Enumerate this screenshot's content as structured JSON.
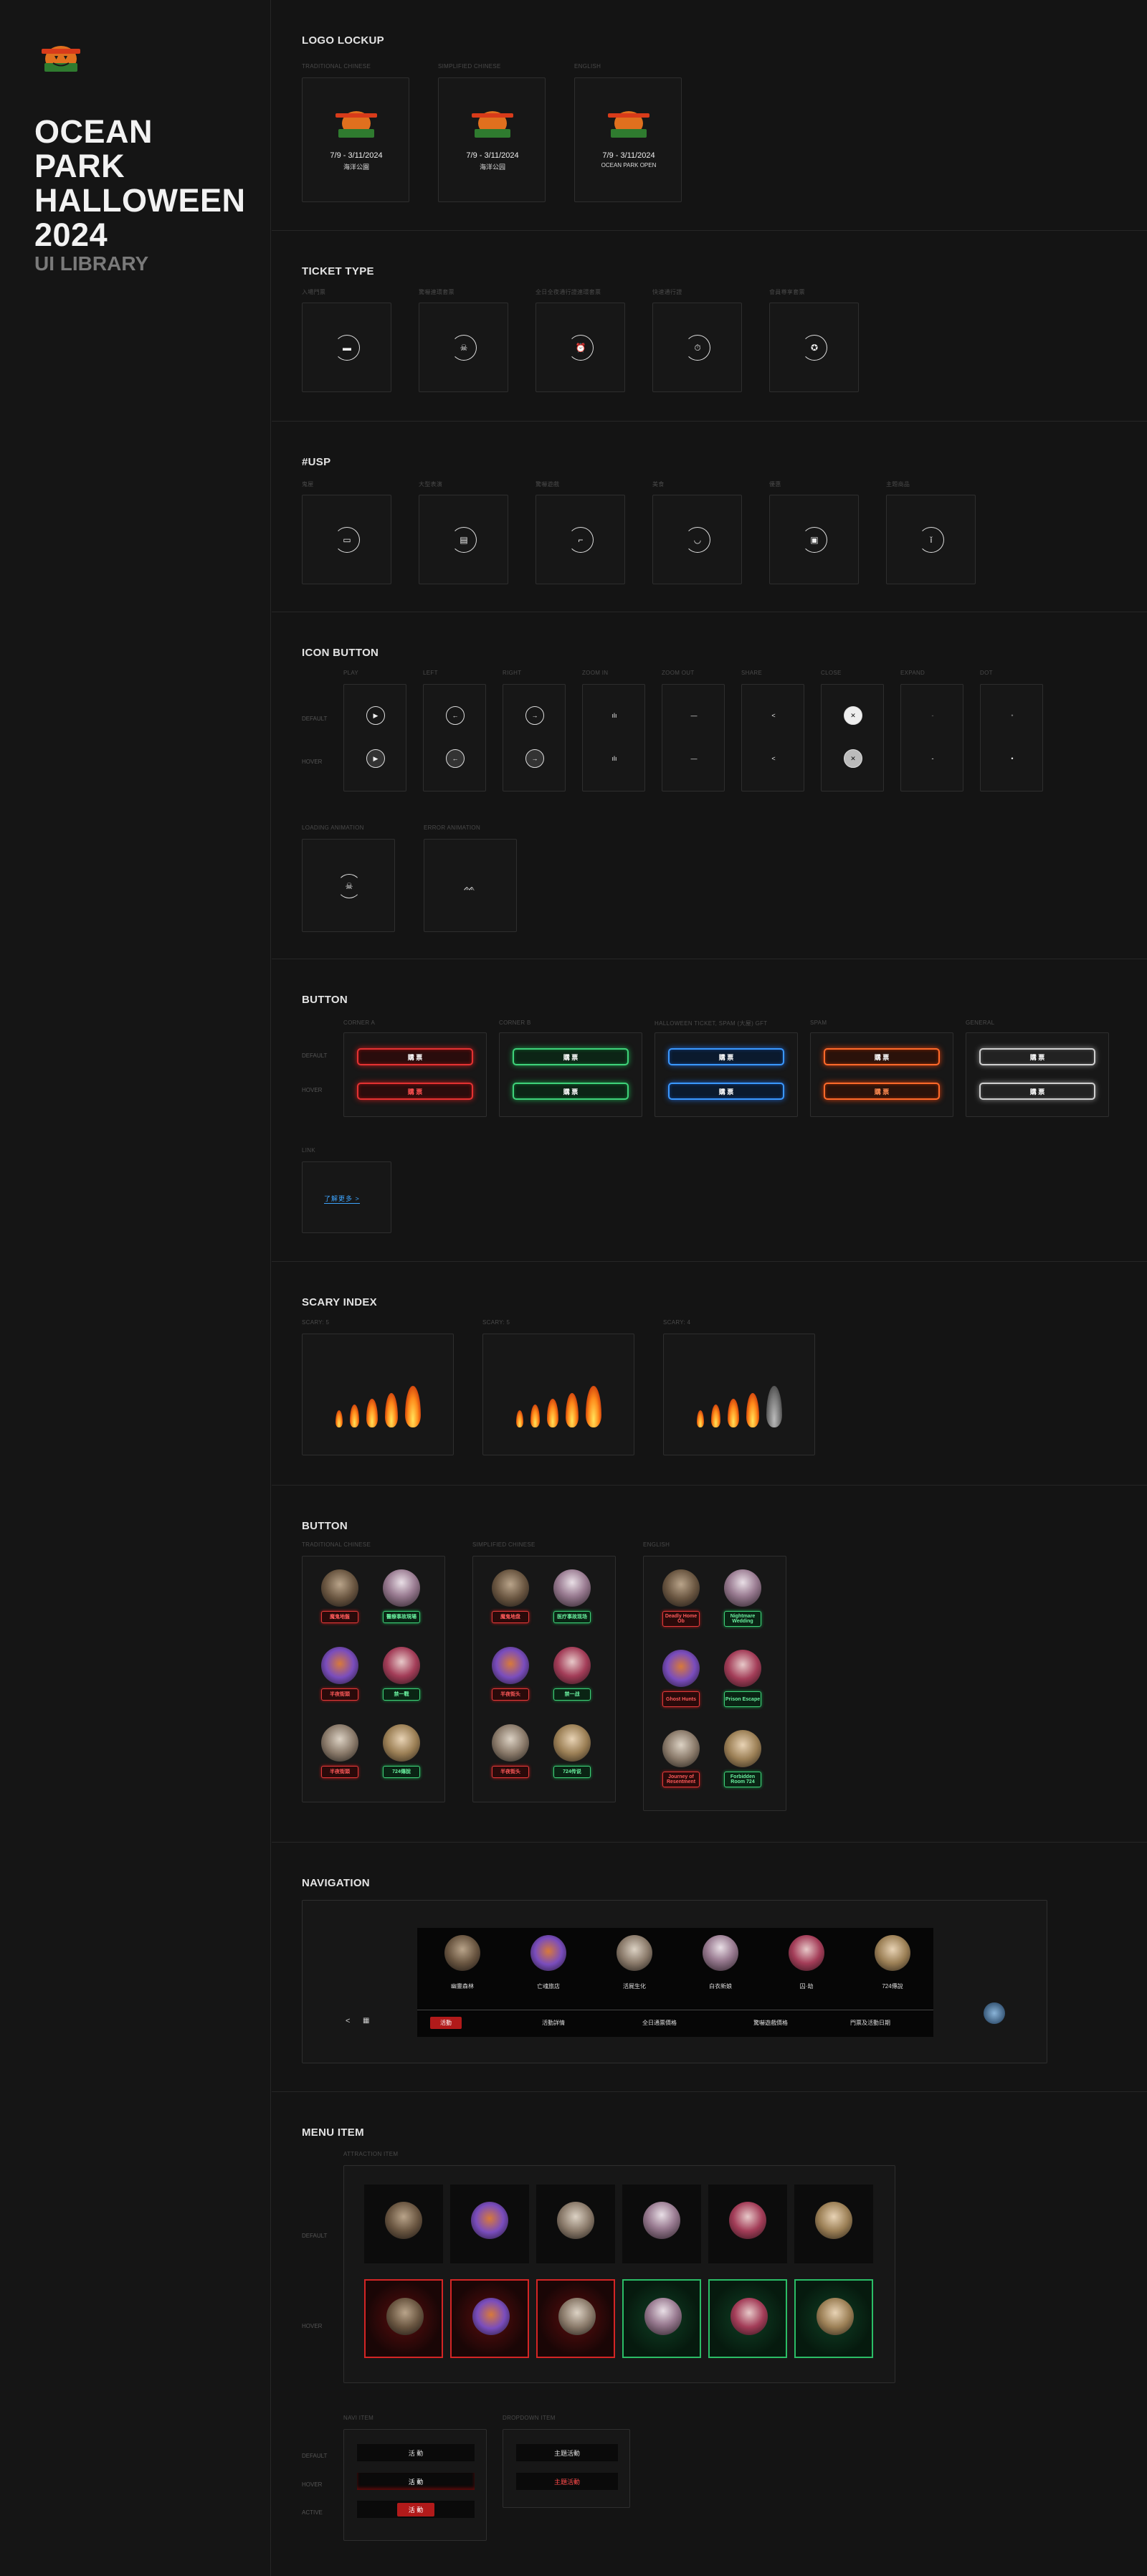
{
  "brand": {
    "title": "OCEAN PARK HALLOWEEN 2024",
    "subtitle": "UI LIBRARY",
    "logo_icon": "halloween-pumpkin-logo"
  },
  "logo_lockup": {
    "title": "LOGO LOCKUP",
    "variants": [
      {
        "label": "TRADITIONAL CHINESE",
        "date": "7/9 - 3/11/2024",
        "venue": "海洋公園"
      },
      {
        "label": "SIMPLIFIED CHINESE",
        "date": "7/9 - 3/11/2024",
        "venue": "海洋公园"
      },
      {
        "label": "ENGLISH",
        "date": "7/9 - 3/11/2024",
        "venue": "OCEAN PARK OPEN"
      }
    ]
  },
  "ticket_type": {
    "title": "TICKET TYPE",
    "items": [
      {
        "label": "入場門票",
        "icon": "ticket-icon"
      },
      {
        "label": "驚嚇連環套票",
        "icon": "skull-icon"
      },
      {
        "label": "全日全夜通行證連環套票",
        "icon": "alarm-clock-icon"
      },
      {
        "label": "快速通行證",
        "icon": "stopwatch-icon"
      },
      {
        "label": "會員尊享套票",
        "icon": "medal-icon"
      }
    ]
  },
  "usp": {
    "title": "#USP",
    "items": [
      {
        "label": "鬼屋",
        "icon": "car-icon"
      },
      {
        "label": "大型表演",
        "icon": "presentation-icon"
      },
      {
        "label": "驚嚇遊戲",
        "icon": "plug-icon"
      },
      {
        "label": "美食",
        "icon": "food-bowl-icon"
      },
      {
        "label": "優惠",
        "icon": "coupon-icon"
      },
      {
        "label": "主題商品",
        "icon": "bottle-icon"
      }
    ]
  },
  "icon_button": {
    "title": "ICON BUTTON",
    "row_labels": [
      "DEFAULT",
      "HOVER"
    ],
    "columns": [
      {
        "label": "PLAY",
        "icon": "play-icon",
        "glyph": "▶"
      },
      {
        "label": "LEFT",
        "icon": "arrow-left-icon",
        "glyph": "←"
      },
      {
        "label": "RIGHT",
        "icon": "arrow-right-icon",
        "glyph": "→"
      },
      {
        "label": "ZOOM IN",
        "icon": "zoom-in-icon",
        "glyph": "ılı"
      },
      {
        "label": "ZOOM OUT",
        "icon": "zoom-out-icon",
        "glyph": "—"
      },
      {
        "label": "SHARE",
        "icon": "share-icon",
        "glyph": "<"
      },
      {
        "label": "CLOSE",
        "icon": "close-icon",
        "glyph": "✕"
      },
      {
        "label": "EXPAND",
        "icon": "expand-icon",
        "glyph": "-"
      },
      {
        "label": "DOT",
        "icon": "dot-icon",
        "glyph": "•"
      }
    ],
    "animations": [
      {
        "label": "LOADING ANIMATION",
        "icon": "skull-loading-icon"
      },
      {
        "label": "ERROR ANIMATION",
        "icon": "bat-icon"
      }
    ]
  },
  "button": {
    "title": "BUTTON",
    "row_labels": [
      "DEFAULT",
      "HOVER"
    ],
    "variants": [
      {
        "label": "CORNER A",
        "style": "red",
        "default": "購 票",
        "hover": "購 票"
      },
      {
        "label": "CORNER B",
        "style": "green",
        "default": "購 票",
        "hover": "購 票"
      },
      {
        "label": "HALLOWEEN TICKET, SPAM (大屋) GFT",
        "style": "blue",
        "default": "購 票",
        "hover": "購 票"
      },
      {
        "label": "SPAM",
        "style": "orange",
        "default": "購 票",
        "hover": "購 票"
      },
      {
        "label": "GENERAL",
        "style": "grey",
        "default": "購 票",
        "hover": "購 票"
      }
    ],
    "link_label": "LINK",
    "link_text": "了解更多 >"
  },
  "scary_index": {
    "title": "SCARY INDEX",
    "items": [
      {
        "label": "SCARY: 5",
        "level": 5
      },
      {
        "label": "SCARY: 5",
        "level": 5
      },
      {
        "label": "SCARY: 4",
        "level": 4
      }
    ]
  },
  "character_button": {
    "title": "BUTTON",
    "columns": [
      {
        "label": "TRADITIONAL CHINESE",
        "tags": [
          "魔鬼地盤",
          "醫療事故現場",
          "半夜街頭",
          "禁一戰",
          "半夜街頭",
          "724傳說"
        ]
      },
      {
        "label": "SIMPLIFIED CHINESE",
        "tags": [
          "魔鬼地盘",
          "医疗事故现场",
          "半夜街头",
          "禁一战",
          "半夜街头",
          "724传说"
        ]
      },
      {
        "label": "ENGLISH",
        "tags": [
          "Deadly Home Ob",
          "Nightmare Wedding",
          "Ghost Hunts",
          "Prison Escape",
          "Journey of Resentment",
          "Forbidden Room 724"
        ]
      }
    ]
  },
  "navigation": {
    "title": "NAVIGATION",
    "items": [
      "幽靈森林",
      "亡魂旅店",
      "活屍生化",
      "白衣新娘",
      "囚·劫",
      "724傳說"
    ],
    "tabs": [
      "活動",
      "活動詳情",
      "全日通票價格",
      "驚嚇遊戲價格",
      "門票及活動日期"
    ],
    "share_icon": "share-icon",
    "calendar_icon": "calendar-icon",
    "chat_icon": "chat-bot-icon"
  },
  "menu_item": {
    "title": "MENU ITEM",
    "attraction_label": "ATTRACTION ITEM",
    "row_labels": [
      "DEFAULT",
      "HOVER"
    ],
    "nav_item_label": "NAVI ITEM",
    "nav_rows": [
      "DEFAULT",
      "HOVER",
      "ACTIVE"
    ],
    "nav_text": "活 動",
    "dropdown_label": "DROPDOWN ITEM",
    "dropdown_items": [
      "主題活動",
      "主題活動"
    ]
  }
}
